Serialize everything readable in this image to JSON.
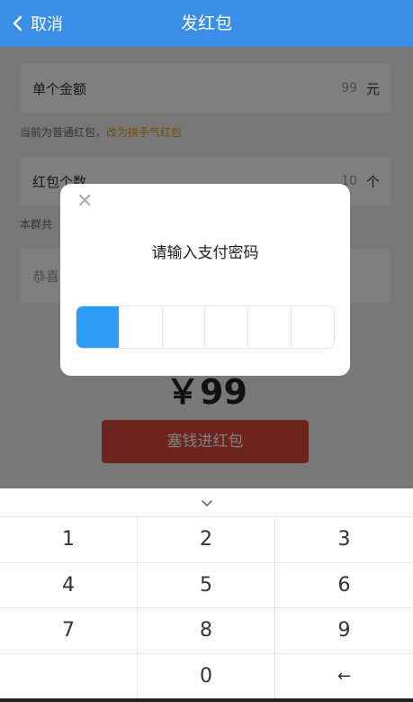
{
  "header": {
    "back_label": "取消",
    "title": "发红包"
  },
  "form": {
    "amount_field": {
      "label": "单个金额",
      "value": "99",
      "unit": "元"
    },
    "hint1": {
      "text": "当前为普通红包，",
      "link": "改为拼手气红包"
    },
    "count_field": {
      "label": "红包个数",
      "value": "10",
      "unit": "个"
    },
    "hint2": "本群共",
    "greeting_placeholder": "恭喜",
    "total": "￥99",
    "submit_label": "塞钱进红包"
  },
  "modal": {
    "close_glyph": "✕",
    "title": "请输入支付密码",
    "pin_length": 6,
    "filled": 1
  },
  "keyboard": {
    "keys": [
      "1",
      "2",
      "3",
      "4",
      "5",
      "6",
      "7",
      "8",
      "9",
      "",
      "0",
      "←"
    ]
  },
  "colors": {
    "header": "#3a8ee6",
    "accent_link": "#d4a017",
    "submit": "#d84a3a",
    "pin_active": "#2e9bf5"
  }
}
